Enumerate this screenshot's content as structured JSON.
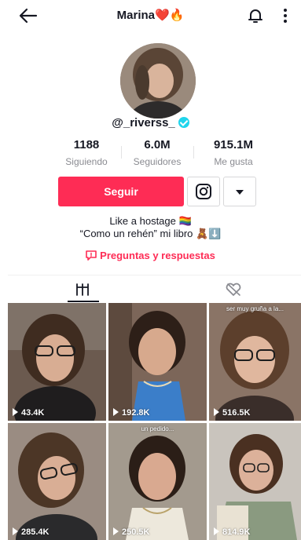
{
  "header": {
    "title": "Marina❤️🔥"
  },
  "profile": {
    "username": "@_riverss_"
  },
  "stats": [
    {
      "value": "1188",
      "label": "Siguiendo"
    },
    {
      "value": "6.0M",
      "label": "Seguidores"
    },
    {
      "value": "915.1M",
      "label": "Me gusta"
    }
  ],
  "actions": {
    "follow_label": "Seguir"
  },
  "bio": {
    "line1": "Like a hostage 🏳️‍🌈",
    "line2": "“Como un rehén” mi libro 🧸⬇️"
  },
  "qa": {
    "label": "Preguntas y respuestas"
  },
  "videos": [
    {
      "views": "43.4K",
      "overlay": ""
    },
    {
      "views": "192.8K",
      "overlay": ""
    },
    {
      "views": "516.5K",
      "overlay": "ser muy gruña a la..."
    },
    {
      "views": "285.4K",
      "overlay": ""
    },
    {
      "views": "250.5K",
      "overlay": "un pedido..."
    },
    {
      "views": "814.9K",
      "overlay": ""
    }
  ],
  "colors": {
    "accent": "#fe2c55",
    "verified": "#20d5ec"
  }
}
